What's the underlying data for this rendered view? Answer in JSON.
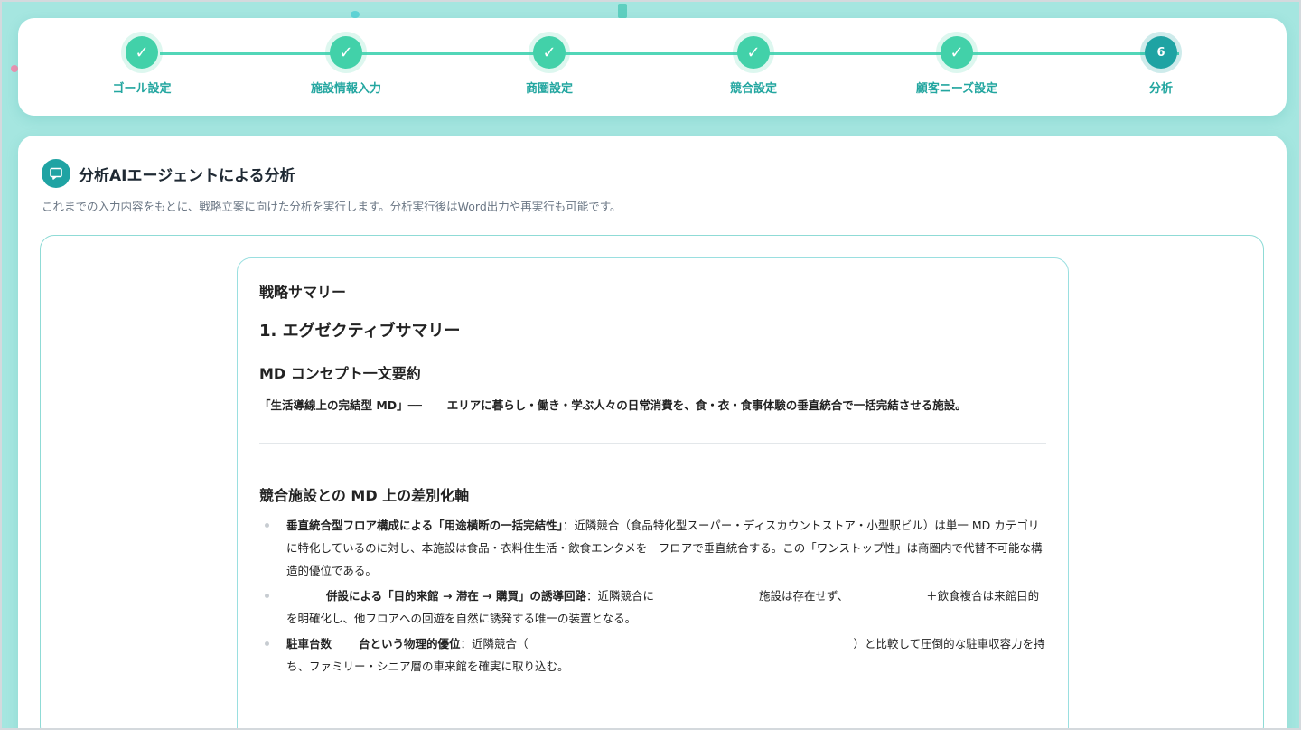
{
  "stepper": {
    "steps": [
      {
        "label": "ゴール設定",
        "mark": "✓",
        "state": "done"
      },
      {
        "label": "施設情報入力",
        "mark": "✓",
        "state": "done"
      },
      {
        "label": "商圏設定",
        "mark": "✓",
        "state": "done"
      },
      {
        "label": "競合設定",
        "mark": "✓",
        "state": "done"
      },
      {
        "label": "顧客ニーズ設定",
        "mark": "✓",
        "state": "done"
      },
      {
        "label": "分析",
        "mark": "6",
        "state": "current"
      }
    ]
  },
  "analysis": {
    "icon": "chat-icon",
    "title": "分析AIエージェントによる分析",
    "description": "これまでの入力内容をもとに、戦略立案に向けた分析を実行します。分析実行後はWord出力や再実行も可能です。"
  },
  "doc": {
    "title": "戦略サマリー",
    "h1": "1. エグゼクティブサマリー",
    "concept_heading": "MD コンセプト一文要約",
    "concept_bold": "「生活導線上の完結型 MD」──",
    "concept_rest": "エリアに暮らし・働き・学ぶ人々の日常消費を、食・衣・食事体験の垂直統合で一括完結させる施設。",
    "diff_heading": "競合施設との MD 上の差別化軸",
    "bullets": [
      {
        "bold": "垂直統合型フロア構成による「用途横断の一括完結性」",
        "rest": "：近隣競合（食品特化型スーパー・ディスカウントストア・小型駅ビル）は単一 MD カテゴリに特化しているのに対し、本施設は食品・衣料住生活・飲食エンタメを　フロアで垂直統合する。この「ワンストップ性」は商圏内で代替不可能な構造的優位である。"
      },
      {
        "bold": "併設による「目的来館 → 滞在 → 購買」の誘導回路",
        "rest_a": "：近隣競合に",
        "rest_b": "施設は存在せず、",
        "rest_c": "＋飲食複合は来館目的を明確化し、他フロアへの回遊を自然に誘発する唯一の装置となる。"
      },
      {
        "bold_a": "駐車台数",
        "bold_b": "台という物理的優位",
        "rest_a": "：近隣競合（",
        "rest_b": "）と比較して圧倒的な駐車収容力を持ち、ファミリー・シニア層の車来館を確実に取り込む。"
      }
    ]
  },
  "colors": {
    "background": "#a5e6e0",
    "step_done": "#42d1a9",
    "step_current": "#1fa3a3",
    "step_label": "#23a6a0",
    "border": "#8fdbd6"
  }
}
